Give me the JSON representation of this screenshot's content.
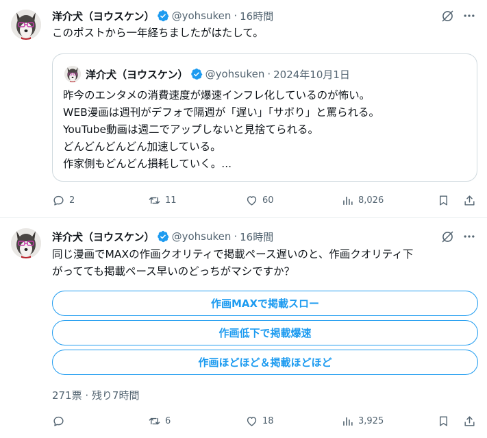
{
  "colors": {
    "accent": "#1d9bf0",
    "secondary_text": "#536471",
    "primary_text": "#0f1419",
    "border": "#cfd9de"
  },
  "tweets": [
    {
      "author": {
        "name": "洋介犬（ヨウスケン）",
        "handle": "@yohsuken",
        "verified": true,
        "avatar_icon": "husky-dog-avatar"
      },
      "time": "16時間",
      "separator": "·",
      "text": "このポストから一年経ちましたがはたして。",
      "quote": {
        "author": {
          "name": "洋介犬（ヨウスケン）",
          "handle": "@yohsuken",
          "verified": true
        },
        "date": "2024年10月1日",
        "separator": "·",
        "lines": [
          "昨今のエンタメの消費速度が爆速インフレ化しているのが怖い。",
          "WEB漫画は週刊がデフォで隔週が「遅い」「サボり」と罵られる。",
          "YouTube動画は週二でアップしないと見捨てられる。",
          "どんどんどんどん加速している。",
          "作家側もどんどん損耗していく。..."
        ]
      },
      "actions": {
        "replies": "2",
        "reposts": "11",
        "likes": "60",
        "views": "8,026"
      }
    },
    {
      "author": {
        "name": "洋介犬（ヨウスケン）",
        "handle": "@yohsuken",
        "verified": true,
        "avatar_icon": "husky-dog-avatar"
      },
      "time": "16時間",
      "separator": "·",
      "text_lines": [
        "同じ漫画でMAXの作画クオリティで掲載ペース遅いのと、作画クオリティ下",
        "がってても掲載ペース早いのどっちがマシですか？"
      ],
      "poll": {
        "options": [
          "作画MAXで掲載スロー",
          "作画低下で掲載爆速",
          "作画ほどほど＆掲載ほどほど"
        ],
        "meta": "271票 · 残り7時間"
      },
      "actions": {
        "replies": "",
        "reposts": "6",
        "likes": "18",
        "views": "3,925"
      }
    }
  ]
}
